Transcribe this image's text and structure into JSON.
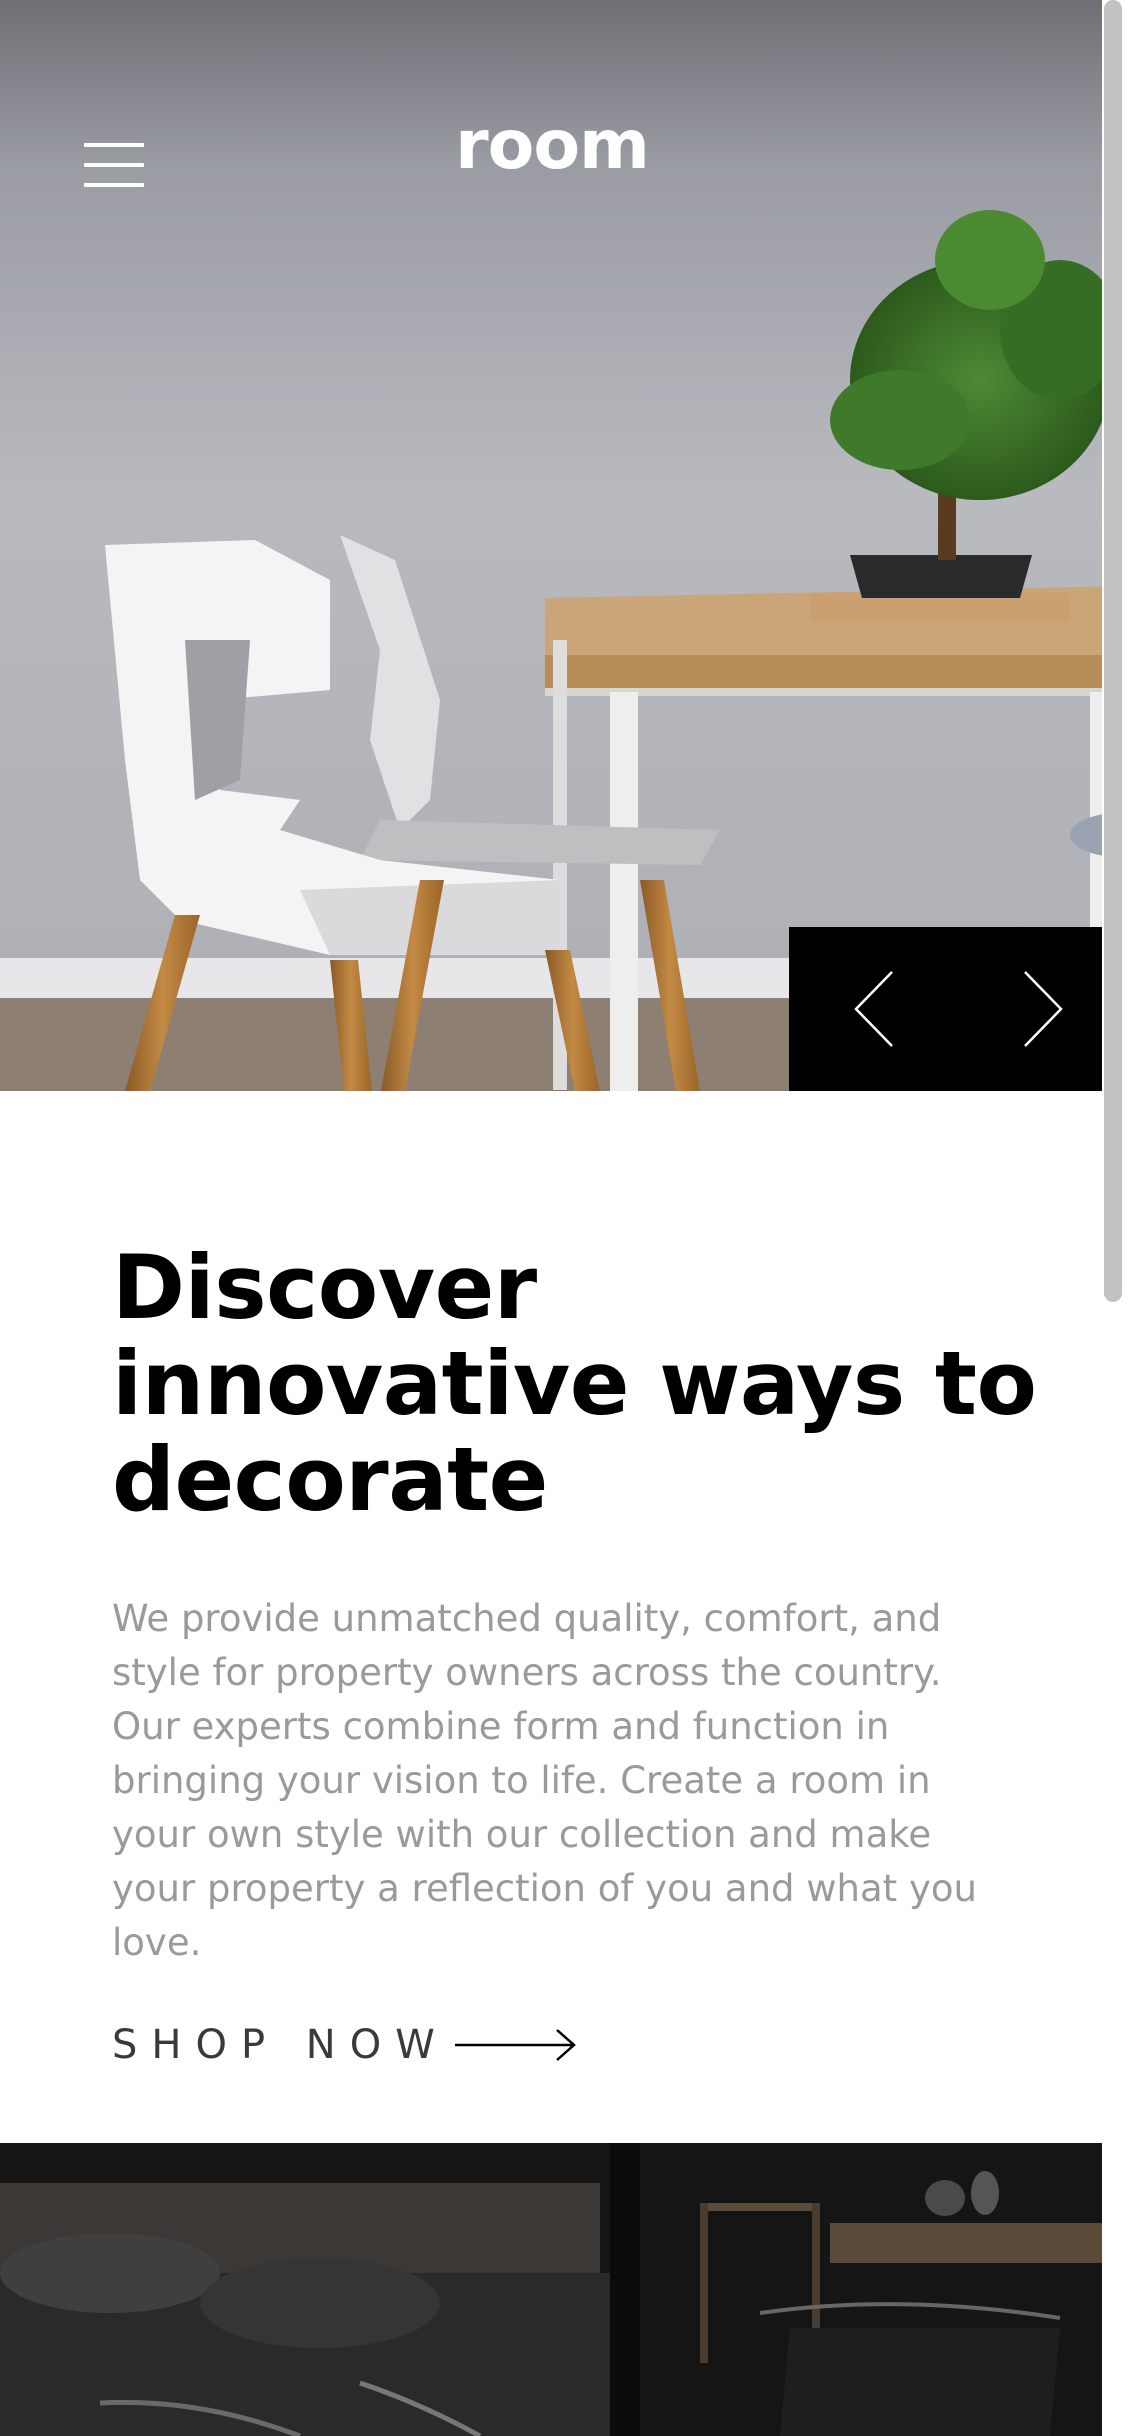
{
  "header": {
    "logo": "room",
    "menu_icon": "hamburger-menu-icon"
  },
  "hero": {
    "image": "white-chairs-and-bonsai-table",
    "prev_icon": "chevron-left-icon",
    "next_icon": "chevron-right-icon"
  },
  "intro": {
    "title": "Discover innovative ways to decorate",
    "body": "We provide unmatched quality, comfort, and style for property owners across the country. Our experts combine form and function in bringing your vision to life. Create a room in your own style with our collection and make your property a reflection of you and what you love.",
    "cta_label": "SHOP NOW",
    "cta_icon": "arrow-right-icon"
  },
  "next_section": {
    "image": "dark-interior-furniture"
  },
  "colors": {
    "text_primary": "#000000",
    "text_muted": "#9a9a9a",
    "controls_bg": "#000000",
    "dark_section_bg": "#141414"
  }
}
